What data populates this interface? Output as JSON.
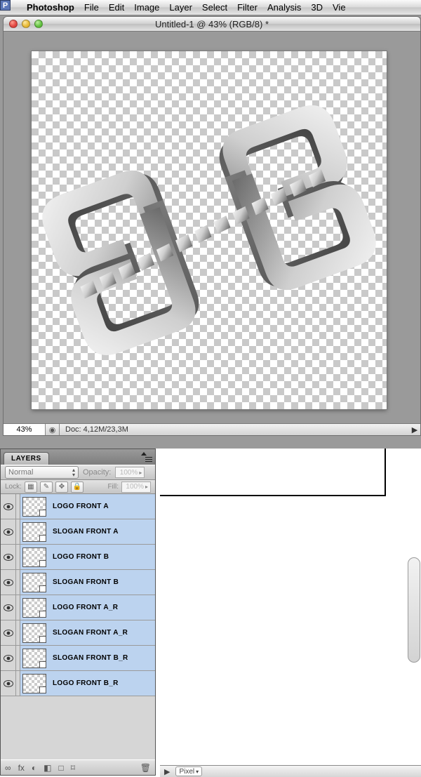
{
  "menubar": {
    "apple": "",
    "appname": "Photoshop",
    "items": [
      "File",
      "Edit",
      "Image",
      "Layer",
      "Select",
      "Filter",
      "Analysis",
      "3D",
      "Vie"
    ]
  },
  "doc": {
    "title": "Untitled-1 @ 43% (RGB/8) *",
    "zoom": "43%",
    "info": "Doc: 4,12M/23,3M",
    "play": "▶"
  },
  "layers_panel": {
    "tab": "LAYERS",
    "blend_mode": "Normal",
    "opacity_label": "Opacity:",
    "opacity_value": "100%",
    "lock_label": "Lock:",
    "fill_label": "Fill:",
    "fill_value": "100%",
    "layers": [
      {
        "name": "LOGO FRONT A"
      },
      {
        "name": "SLOGAN FRONT A"
      },
      {
        "name": "LOGO FRONT B"
      },
      {
        "name": "SLOGAN FRONT B"
      },
      {
        "name": "LOGO FRONT A_R"
      },
      {
        "name": "SLOGAN FRONT A_R"
      },
      {
        "name": "SLOGAN FRONT B_R"
      },
      {
        "name": "LOGO FRONT B_R"
      }
    ],
    "footer_icons": [
      "∞",
      "fx",
      "◐",
      "◧",
      "□",
      "⌑",
      "🗑"
    ]
  },
  "bottombar": {
    "tri": "▶",
    "unit": "Pixel"
  }
}
